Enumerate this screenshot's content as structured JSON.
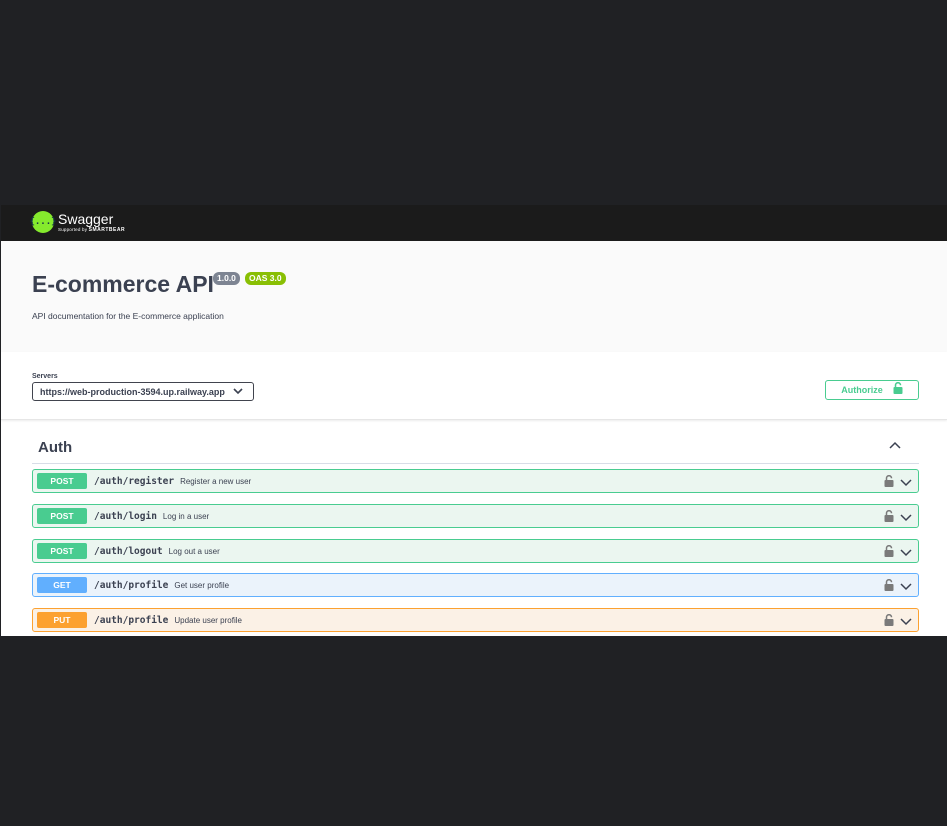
{
  "topbar": {
    "logo_name": "Swagger",
    "logo_sub_prefix": "Supported by",
    "logo_sub_brand": "SMARTBEAR",
    "logo_mark": "{...}"
  },
  "info": {
    "title": "E-commerce API",
    "version": "1.0.0",
    "oas": "OAS 3.0",
    "description": "API documentation for the E-commerce application"
  },
  "servers": {
    "label": "Servers",
    "selected": "https://web-production-3594.up.railway.app"
  },
  "authorize": {
    "label": "Authorize",
    "icon": "unlock-icon"
  },
  "tag": {
    "name": "Auth",
    "expanded": true
  },
  "operations": [
    {
      "method": "POST",
      "path": "/auth/register",
      "summary": "Register a new user"
    },
    {
      "method": "POST",
      "path": "/auth/login",
      "summary": "Log in a user"
    },
    {
      "method": "POST",
      "path": "/auth/logout",
      "summary": "Log out a user"
    },
    {
      "method": "GET",
      "path": "/auth/profile",
      "summary": "Get user profile"
    },
    {
      "method": "PUT",
      "path": "/auth/profile",
      "summary": "Update user profile"
    }
  ],
  "colors": {
    "post": "#49cc90",
    "get": "#61affe",
    "put": "#fca130",
    "background": "#202124",
    "topbar": "#1b1b1b",
    "logo": "#85ea2d"
  }
}
